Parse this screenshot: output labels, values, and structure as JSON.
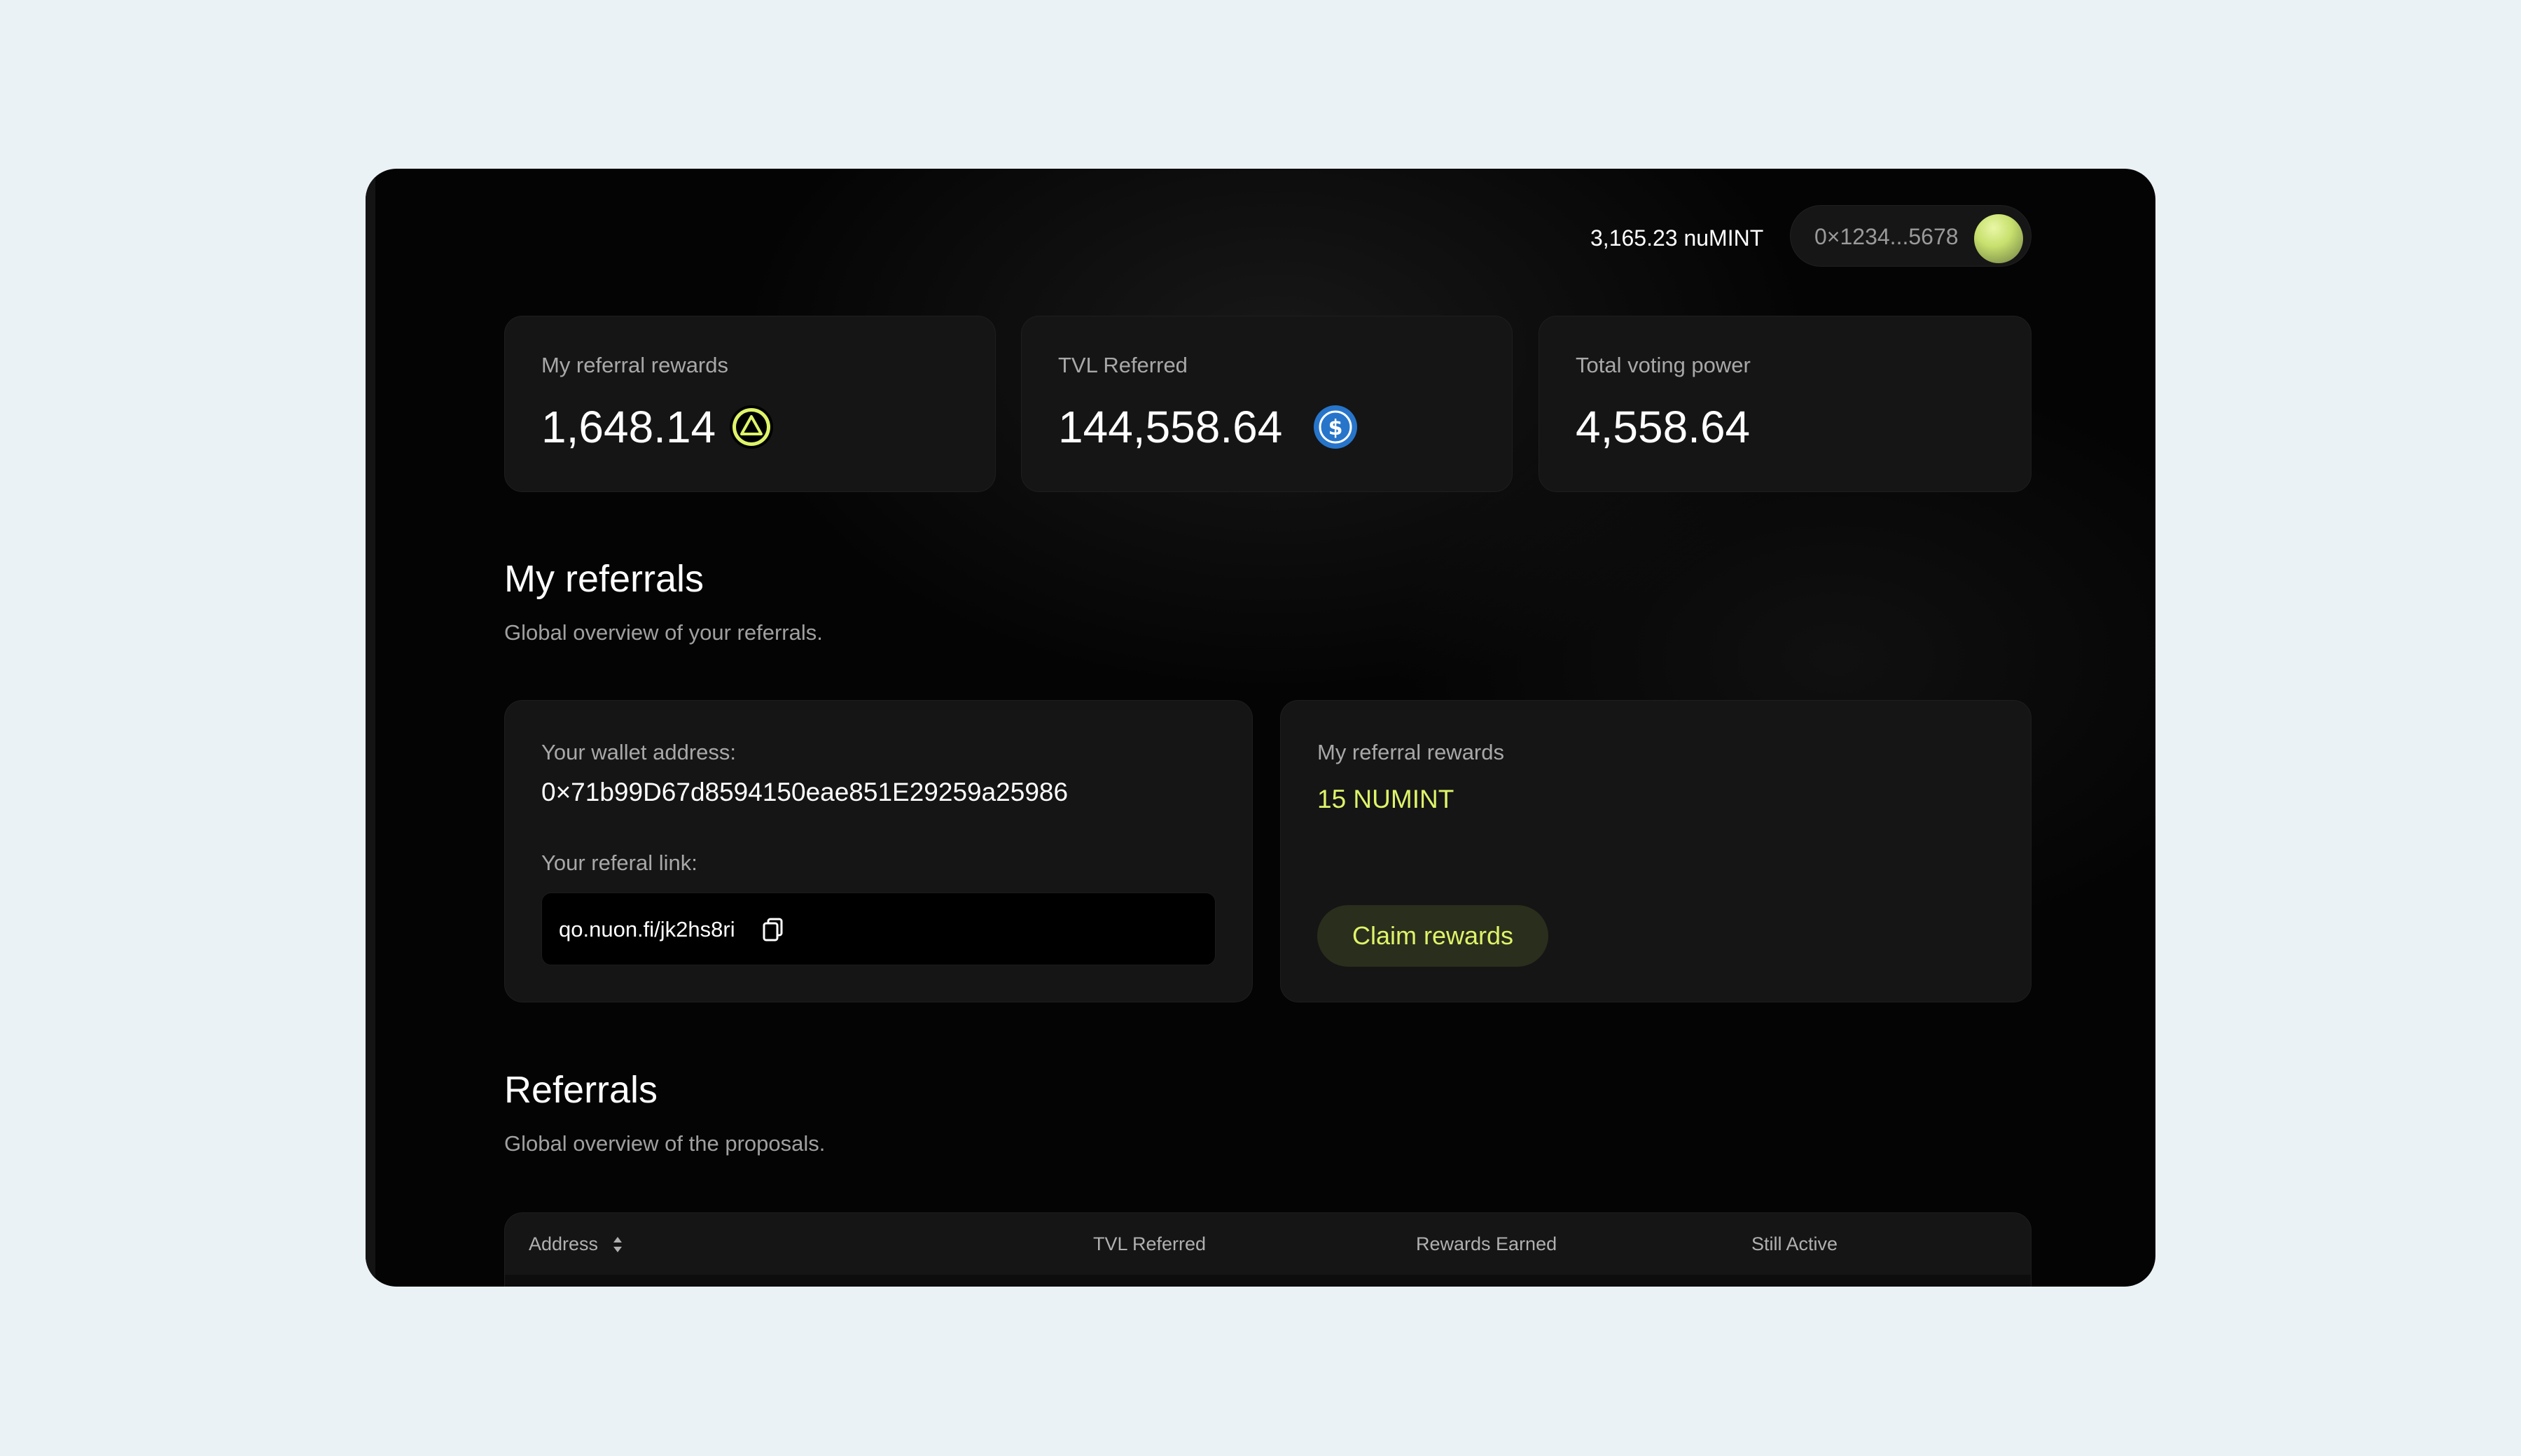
{
  "header": {
    "balance": "3,165.23 nuMINT",
    "wallet_short": "0×1234...5678"
  },
  "stats": [
    {
      "label": "My referral rewards",
      "value": "1,648.14",
      "icon": "nuon-triangle-icon",
      "icon_color": "#dff36a"
    },
    {
      "label": "TVL Referred",
      "value": "144,558.64",
      "icon": "usdc-dollar-icon",
      "icon_color": "#2775ca"
    },
    {
      "label": "Total voting power",
      "value": "4,558.64"
    }
  ],
  "my_referrals": {
    "title": "My referrals",
    "subtitle": "Global overview of your referrals.",
    "wallet_label": "Your wallet address:",
    "wallet_address": "0×71b99D67d8594150eae851E29259a25986",
    "link_label": "Your referal link:",
    "link": "qo.nuon.fi/jk2hs8ri",
    "rewards_label": "My referral rewards",
    "rewards_amount": "15 NUMINT",
    "claim_label": "Claim rewards"
  },
  "referrals": {
    "title": "Referrals",
    "subtitle": "Global overview of the proposals.",
    "columns": [
      "Address",
      "TVL Referred",
      "Rewards Earned",
      "Still Active"
    ]
  },
  "colors": {
    "page_bg": "#ebf2f6",
    "window_bg": "#040404",
    "card_bg": "#151515",
    "accent": "#dff36a",
    "usdc_blue": "#2775ca"
  }
}
